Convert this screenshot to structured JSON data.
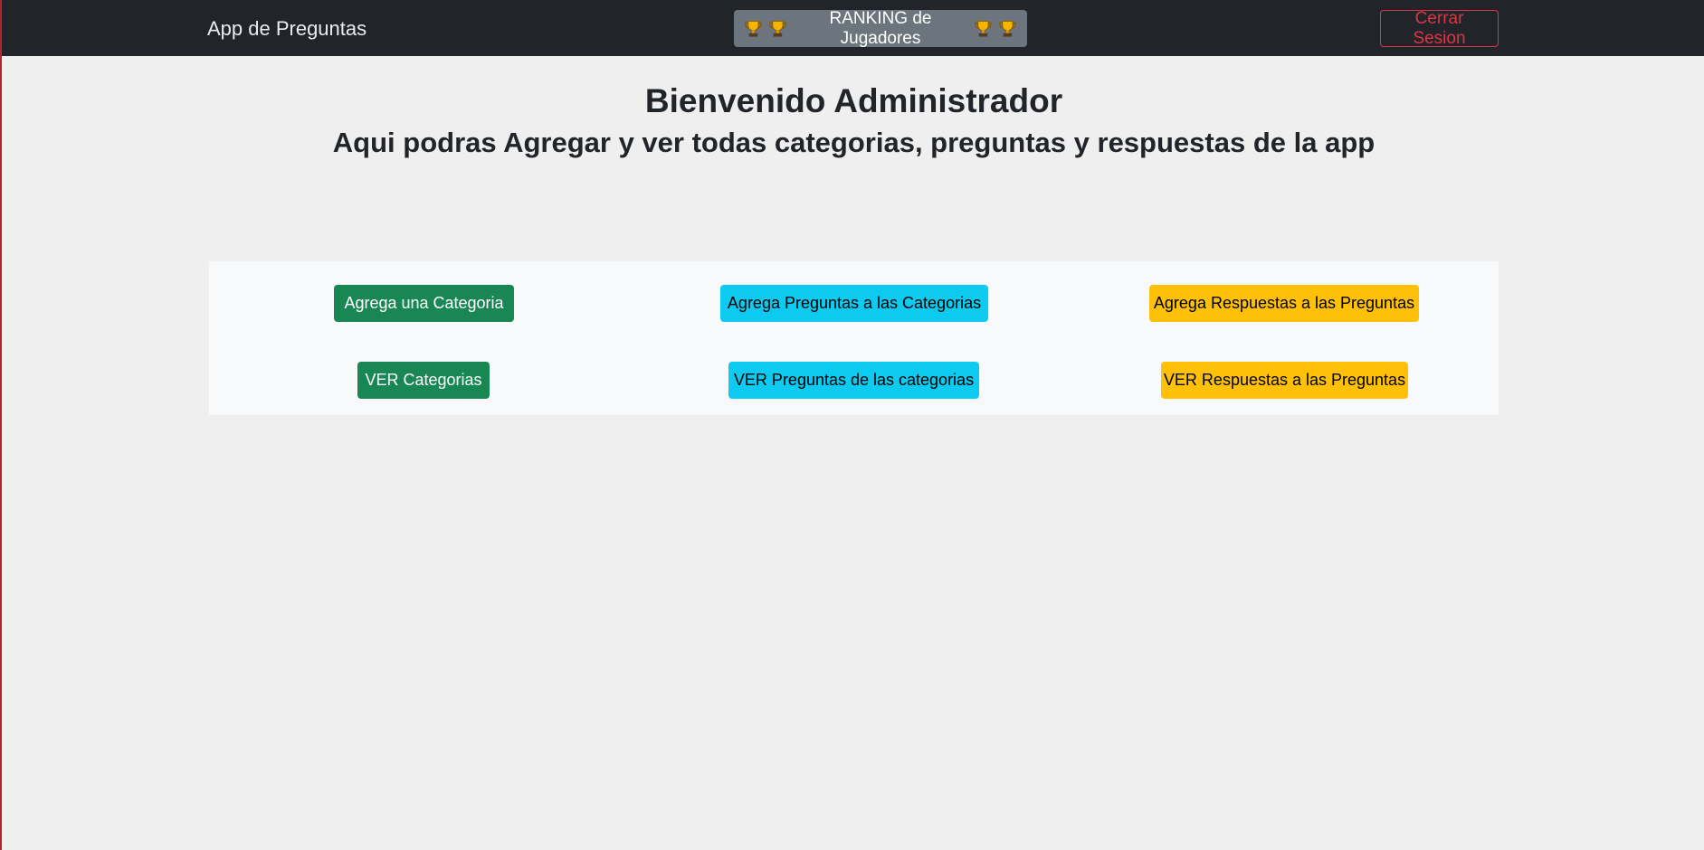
{
  "navbar": {
    "brand": "App de Preguntas",
    "ranking_label": "RANKING de Jugadores",
    "ranking_icon": "trophy-icon",
    "logout_label": "Cerrar Sesion"
  },
  "main": {
    "title": "Bienvenido Administrador",
    "subtitle": "Aqui podras Agregar y ver todas categorias, preguntas y respuestas de la app"
  },
  "actions": {
    "add_category": "Agrega una Categoria",
    "add_questions": "Agrega Preguntas a las Categorias",
    "add_answers": "Agrega Respuestas a las Preguntas",
    "view_categories": "VER Categorias",
    "view_questions": "VER Preguntas de las categorias",
    "view_answers": "VER Respuestas a las Preguntas"
  },
  "colors": {
    "navbar_bg": "#212529",
    "success": "#198754",
    "info": "#0dcaf0",
    "warning": "#ffc107",
    "danger": "#dc3545",
    "secondary": "#6c757d"
  }
}
